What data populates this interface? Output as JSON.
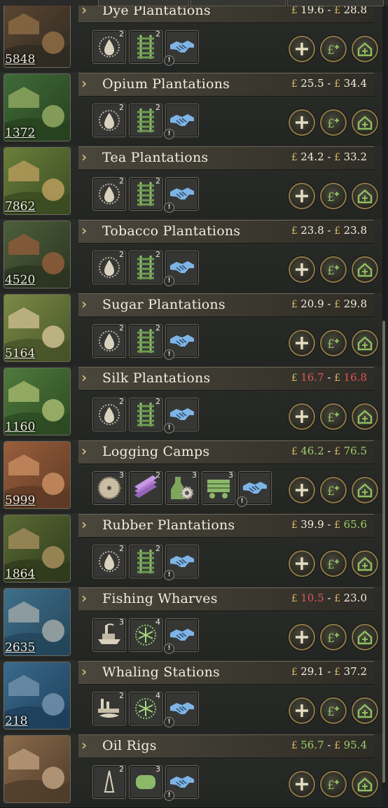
{
  "rows": [
    {
      "name": "Dye Plantations",
      "count": "5848",
      "low": "19.6",
      "high": "28.8",
      "low_color": "",
      "high_color": "",
      "scene": "dye",
      "mods": [
        {
          "icon": "drop-saw-icon",
          "level": "2"
        },
        {
          "icon": "rails-icon",
          "level": "2"
        },
        {
          "icon": "handshake-icon",
          "level": ""
        }
      ]
    },
    {
      "name": "Opium Plantations",
      "count": "1372",
      "low": "25.5",
      "high": "34.4",
      "low_color": "",
      "high_color": "",
      "scene": "opium",
      "mods": [
        {
          "icon": "drop-saw-icon",
          "level": "2"
        },
        {
          "icon": "rails-icon",
          "level": "2"
        },
        {
          "icon": "handshake-icon",
          "level": ""
        }
      ]
    },
    {
      "name": "Tea Plantations",
      "count": "7862",
      "low": "24.2",
      "high": "33.2",
      "low_color": "",
      "high_color": "",
      "scene": "tea",
      "mods": [
        {
          "icon": "drop-saw-icon",
          "level": "2"
        },
        {
          "icon": "rails-icon",
          "level": "2"
        },
        {
          "icon": "handshake-icon",
          "level": ""
        }
      ]
    },
    {
      "name": "Tobacco Plantations",
      "count": "4520",
      "low": "23.8",
      "high": "23.8",
      "low_color": "",
      "high_color": "",
      "scene": "tobacco",
      "mods": [
        {
          "icon": "drop-saw-icon",
          "level": "2"
        },
        {
          "icon": "rails-icon",
          "level": "2"
        },
        {
          "icon": "handshake-icon",
          "level": ""
        }
      ]
    },
    {
      "name": "Sugar Plantations",
      "count": "5164",
      "low": "20.9",
      "high": "29.8",
      "low_color": "",
      "high_color": "",
      "scene": "sugar",
      "mods": [
        {
          "icon": "drop-saw-icon",
          "level": "2"
        },
        {
          "icon": "rails-icon",
          "level": "2"
        },
        {
          "icon": "handshake-icon",
          "level": ""
        }
      ]
    },
    {
      "name": "Silk Plantations",
      "count": "1160",
      "low": "16.7",
      "high": "16.8",
      "low_color": "red",
      "high_color": "red",
      "scene": "silk",
      "mods": [
        {
          "icon": "drop-saw-icon",
          "level": "2"
        },
        {
          "icon": "rails-icon",
          "level": "2"
        },
        {
          "icon": "handshake-icon",
          "level": ""
        }
      ]
    },
    {
      "name": "Logging Camps",
      "count": "5999",
      "low": "46.2",
      "high": "76.5",
      "low_color": "green",
      "high_color": "green",
      "scene": "logging",
      "mods": [
        {
          "icon": "saw-blade-icon",
          "level": "3"
        },
        {
          "icon": "planks-icon",
          "level": "2"
        },
        {
          "icon": "chemicals-gear-icon",
          "level": "3"
        },
        {
          "icon": "wagon-icon",
          "level": "3"
        },
        {
          "icon": "handshake-icon",
          "level": ""
        }
      ]
    },
    {
      "name": "Rubber Plantations",
      "count": "1864",
      "low": "39.9",
      "high": "65.6",
      "low_color": "",
      "high_color": "green",
      "scene": "rubber",
      "mods": [
        {
          "icon": "drop-saw-icon",
          "level": "2"
        },
        {
          "icon": "rails-icon",
          "level": "2"
        },
        {
          "icon": "handshake-icon",
          "level": ""
        }
      ]
    },
    {
      "name": "Fishing Wharves",
      "count": "2635",
      "low": "10.5",
      "high": "23.0",
      "low_color": "red",
      "high_color": "",
      "scene": "fishing",
      "mods": [
        {
          "icon": "steamboat-icon",
          "level": "3"
        },
        {
          "icon": "refrigeration-icon",
          "level": "4"
        },
        {
          "icon": "handshake-icon",
          "level": ""
        }
      ]
    },
    {
      "name": "Whaling Stations",
      "count": "218",
      "low": "29.1",
      "high": "37.2",
      "low_color": "",
      "high_color": "",
      "scene": "whaling",
      "mods": [
        {
          "icon": "whaling-factory-icon",
          "level": "2"
        },
        {
          "icon": "refrigeration-icon",
          "level": "4"
        },
        {
          "icon": "handshake-icon",
          "level": ""
        }
      ]
    },
    {
      "name": "Oil Rigs",
      "count": "",
      "low": "56.7",
      "high": "95.4",
      "low_color": "green",
      "high_color": "green",
      "scene": "oil",
      "mods": [
        {
          "icon": "drill-icon",
          "level": "2"
        },
        {
          "icon": "tank-icon",
          "level": "3"
        },
        {
          "icon": "handshake-icon",
          "level": ""
        }
      ]
    }
  ],
  "currency_symbol": "£",
  "price_separator": "-",
  "warning_glyph": "!"
}
